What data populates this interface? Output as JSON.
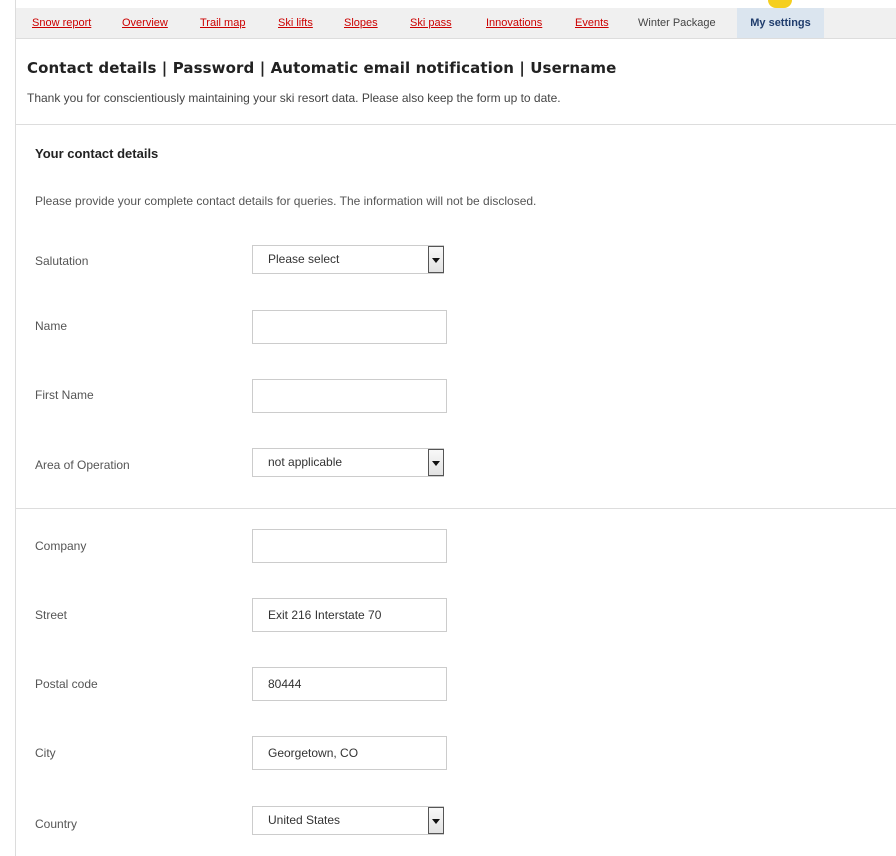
{
  "nav": {
    "items": [
      {
        "label": "Snow report"
      },
      {
        "label": "Overview"
      },
      {
        "label": "Trail map"
      },
      {
        "label": "Ski lifts"
      },
      {
        "label": "Slopes"
      },
      {
        "label": "Ski pass"
      },
      {
        "label": "Innovations"
      },
      {
        "label": "Events"
      },
      {
        "label": "Winter Package"
      },
      {
        "label": "My settings"
      }
    ],
    "active": "My settings",
    "link_color": "#cc0000"
  },
  "page": {
    "heading": "Contact details | Password | Automatic email notification | Username",
    "intro": "Thank you for conscientiously maintaining your ski resort data. Please also keep the form up to date."
  },
  "section": {
    "title": "Your contact details",
    "note": "Please provide your complete contact details for queries. The information will not be disclosed."
  },
  "form": {
    "salutation": {
      "label": "Salutation",
      "value": "Please select"
    },
    "name": {
      "label": "Name",
      "value": ""
    },
    "first_name": {
      "label": "First Name",
      "value": ""
    },
    "area": {
      "label": "Area of Operation",
      "value": "not applicable"
    },
    "company": {
      "label": "Company",
      "value": ""
    },
    "street": {
      "label": "Street",
      "value": "Exit 216 Interstate 70"
    },
    "postal": {
      "label": "Postal code",
      "value": "80444"
    },
    "city": {
      "label": "City",
      "value": "Georgetown, CO"
    },
    "country": {
      "label": "Country",
      "value": "United States"
    }
  }
}
